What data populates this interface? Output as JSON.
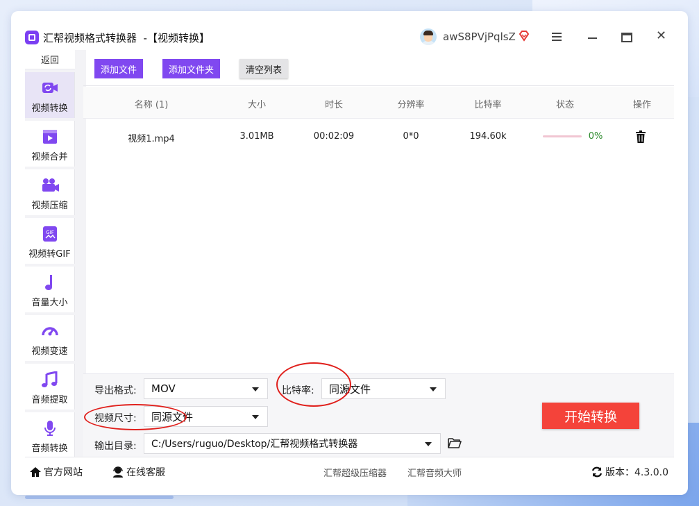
{
  "app": {
    "title": "汇帮视频格式转换器  -【视频转换】",
    "username": "awS8PVjPqlsZ",
    "icons": {
      "logo": "app-logo-icon",
      "vip": "vip-diamond-icon",
      "menu": "menu-icon",
      "minimize": "minimize-icon",
      "maximize": "maximize-icon",
      "close": "close-icon"
    }
  },
  "sidebar": {
    "back_label": "返回",
    "items": [
      {
        "label": "视频转换",
        "icon": "video-convert-icon",
        "active": true
      },
      {
        "label": "视频合并",
        "icon": "video-merge-icon",
        "active": false
      },
      {
        "label": "视频压缩",
        "icon": "video-compress-icon",
        "active": false
      },
      {
        "label": "视频转GIF",
        "icon": "gif-icon",
        "active": false
      },
      {
        "label": "音量大小",
        "icon": "music-note-icon",
        "active": false
      },
      {
        "label": "视频变速",
        "icon": "speedometer-icon",
        "active": false
      },
      {
        "label": "音频提取",
        "icon": "audio-extract-icon",
        "active": false
      },
      {
        "label": "音频转换",
        "icon": "microphone-icon",
        "active": false
      }
    ]
  },
  "toolbar": {
    "add_file": "添加文件",
    "add_folder": "添加文件夹",
    "clear_list": "清空列表"
  },
  "table": {
    "headers": [
      "名称 (1)",
      "大小",
      "时长",
      "分辨率",
      "比特率",
      "状态",
      "操作"
    ],
    "rows": [
      {
        "name": "视频1.mp4",
        "size": "3.01MB",
        "duration": "00:02:09",
        "resolution": "0*0",
        "bitrate": "194.60k",
        "progress": 0,
        "status": "0%",
        "action_icon": "trash-icon"
      }
    ]
  },
  "settings": {
    "format_label": "导出格式:",
    "format_value": "MOV",
    "bitrate_label": "比特率:",
    "bitrate_value": "同源文件",
    "size_label": "视频尺寸:",
    "size_value": "同源文件",
    "output_label": "输出目录:",
    "output_value": "C:/Users/ruguo/Desktop/汇帮视频格式转换器",
    "folder_icon": "folder-open-icon",
    "start_button": "开始转换"
  },
  "footer": {
    "website": "官方网站",
    "support": "在线客服",
    "link1": "汇帮超级压缩器",
    "link2": "汇帮音频大师",
    "version": "版本：4.3.0.0"
  },
  "colors": {
    "accent": "#8048f0",
    "start": "#f4433a",
    "annotation": "#e0201c",
    "progress_ok": "#2e8b2e"
  }
}
